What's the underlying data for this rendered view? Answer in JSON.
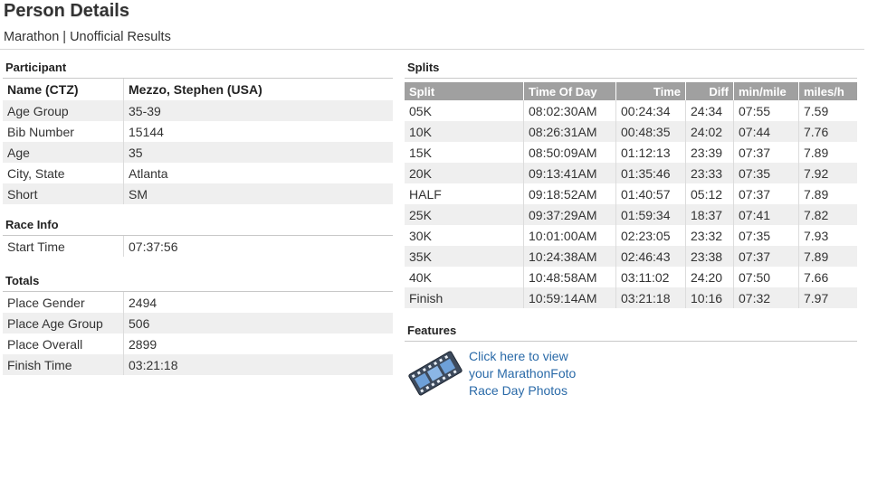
{
  "header": {
    "title": "Person Details",
    "subtitle": "Marathon | Unofficial Results"
  },
  "participant": {
    "heading": "Participant",
    "name_label": "Name (CTZ)",
    "name_value": "Mezzo, Stephen (USA)",
    "rows": [
      {
        "label": "Age Group",
        "value": "35-39"
      },
      {
        "label": "Bib Number",
        "value": "15144"
      },
      {
        "label": "Age",
        "value": "35"
      },
      {
        "label": "City, State",
        "value": "Atlanta"
      },
      {
        "label": "Short",
        "value": "SM"
      }
    ]
  },
  "race_info": {
    "heading": "Race Info",
    "rows": [
      {
        "label": "Start Time",
        "value": "07:37:56"
      }
    ]
  },
  "totals": {
    "heading": "Totals",
    "rows": [
      {
        "label": "Place Gender",
        "value": "2494"
      },
      {
        "label": "Place Age Group",
        "value": "506"
      },
      {
        "label": "Place Overall",
        "value": "2899"
      },
      {
        "label": "Finish Time",
        "value": "03:21:18"
      }
    ]
  },
  "splits": {
    "heading": "Splits",
    "columns": [
      "Split",
      "Time Of Day",
      "Time",
      "Diff",
      "min/mile",
      "miles/h"
    ],
    "rows": [
      [
        "05K",
        "08:02:30AM",
        "00:24:34",
        "24:34",
        "07:55",
        "7.59"
      ],
      [
        "10K",
        "08:26:31AM",
        "00:48:35",
        "24:02",
        "07:44",
        "7.76"
      ],
      [
        "15K",
        "08:50:09AM",
        "01:12:13",
        "23:39",
        "07:37",
        "7.89"
      ],
      [
        "20K",
        "09:13:41AM",
        "01:35:46",
        "23:33",
        "07:35",
        "7.92"
      ],
      [
        "HALF",
        "09:18:52AM",
        "01:40:57",
        "05:12",
        "07:37",
        "7.89"
      ],
      [
        "25K",
        "09:37:29AM",
        "01:59:34",
        "18:37",
        "07:41",
        "7.82"
      ],
      [
        "30K",
        "10:01:00AM",
        "02:23:05",
        "23:32",
        "07:35",
        "7.93"
      ],
      [
        "35K",
        "10:24:38AM",
        "02:46:43",
        "23:38",
        "07:37",
        "7.89"
      ],
      [
        "40K",
        "10:48:58AM",
        "03:11:02",
        "24:20",
        "07:50",
        "7.66"
      ],
      [
        "Finish",
        "10:59:14AM",
        "03:21:18",
        "10:16",
        "07:32",
        "7.97"
      ]
    ]
  },
  "features": {
    "heading": "Features",
    "icon": "film-strip-icon",
    "link_lines": [
      "Click here to view",
      "your MarathonFoto",
      "Race Day Photos"
    ]
  },
  "colors": {
    "link": "#2a6aa8",
    "table_header_bg": "#a0a0a0",
    "alt_row_bg": "#efefef"
  }
}
